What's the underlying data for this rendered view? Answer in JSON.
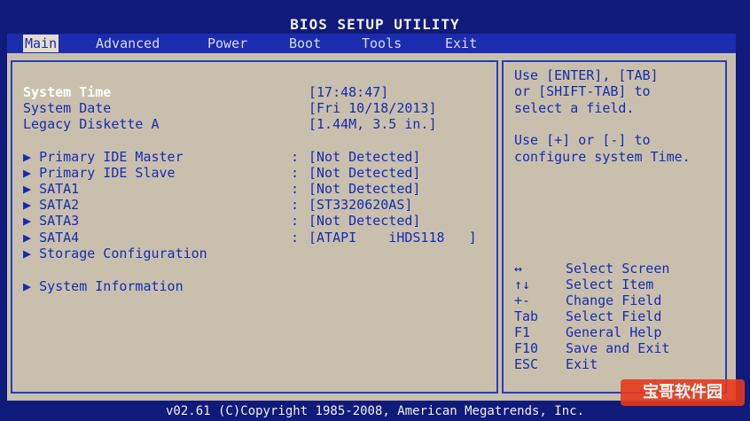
{
  "title": "BIOS SETUP UTILITY",
  "menu": [
    {
      "label": "Main",
      "active": true
    },
    {
      "label": "Advanced",
      "active": false
    },
    {
      "label": "Power",
      "active": false
    },
    {
      "label": "Boot",
      "active": false
    },
    {
      "label": "Tools",
      "active": false
    },
    {
      "label": "Exit",
      "active": false
    }
  ],
  "settings": [
    {
      "label": "System Time",
      "value": "[17:48:47]",
      "colon": false,
      "arrow": false
    },
    {
      "label": "System Date",
      "value": "[Fri 10/18/2013]",
      "colon": false,
      "arrow": false
    },
    {
      "label": "Legacy Diskette A",
      "value": "[1.44M, 3.5 in.]",
      "colon": false,
      "arrow": false
    },
    {
      "label": "Primary IDE Master",
      "value": "[Not Detected]",
      "colon": true,
      "arrow": true
    },
    {
      "label": "Primary IDE Slave",
      "value": "[Not Detected]",
      "colon": true,
      "arrow": true
    },
    {
      "label": "SATA1",
      "value": "[Not Detected]",
      "colon": true,
      "arrow": true
    },
    {
      "label": "SATA2",
      "value": "[ST3320620AS]",
      "colon": true,
      "arrow": true
    },
    {
      "label": "SATA3",
      "value": "[Not Detected]",
      "colon": true,
      "arrow": true
    },
    {
      "label": "SATA4",
      "value": "[ATAPI    iHDS118   ]",
      "colon": true,
      "arrow": true
    },
    {
      "label": "Storage Configuration",
      "value": "",
      "colon": false,
      "arrow": true
    },
    {
      "label": "System Information",
      "value": "",
      "colon": false,
      "arrow": true
    }
  ],
  "help": {
    "line1": "Use [ENTER], [TAB]",
    "line2": "or [SHIFT-TAB] to",
    "line3": "select a field.",
    "line4": "Use [+] or [-] to",
    "line5": "configure system Time."
  },
  "keys": [
    {
      "key": "↔",
      "desc": "Select Screen"
    },
    {
      "key": "↑↓",
      "desc": "Select Item"
    },
    {
      "key": "+-",
      "desc": "Change Field"
    },
    {
      "key": "Tab",
      "desc": "Select Field"
    },
    {
      "key": "F1",
      "desc": "General Help"
    },
    {
      "key": "F10",
      "desc": "Save and Exit"
    },
    {
      "key": "ESC",
      "desc": "Exit"
    }
  ],
  "footer": "v02.61 (C)Copyright 1985-2008, American Megatrends, Inc.",
  "watermark": "宝哥软件园"
}
